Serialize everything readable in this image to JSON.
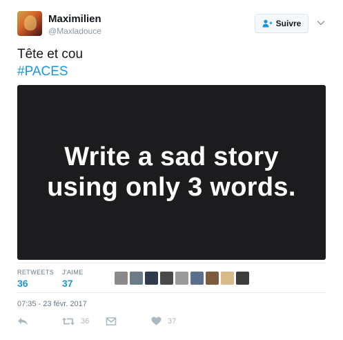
{
  "author": {
    "display_name": "Maximilien",
    "handle": "@Maxladouce"
  },
  "follow_button": {
    "label": "Suivre"
  },
  "tweet": {
    "text": "Tête et cou",
    "hashtag": "#PACES"
  },
  "media": {
    "line1": "Write a sad story",
    "line2": "using only 3 words."
  },
  "stats": {
    "retweets_label": "RETWEETS",
    "retweets_count": "36",
    "likes_label": "J'AIME",
    "likes_count": "37"
  },
  "likers": [
    {
      "color": "#8a8a8a"
    },
    {
      "color": "#6d7a88"
    },
    {
      "color": "#2f3b4a"
    },
    {
      "color": "#4a4a4a"
    },
    {
      "color": "#9a9a9a"
    },
    {
      "color": "#5a6f8e"
    },
    {
      "color": "#7c5b3f"
    },
    {
      "color": "#d9b88a"
    },
    {
      "color": "#3c3c3c"
    }
  ],
  "timestamp": "07:35 - 23 févr. 2017",
  "actions": {
    "retweet_count": "36",
    "like_count": "37"
  },
  "colors": {
    "accent": "#1b95e0",
    "muted": "#657786",
    "media_bg": "#1c1c1e"
  }
}
